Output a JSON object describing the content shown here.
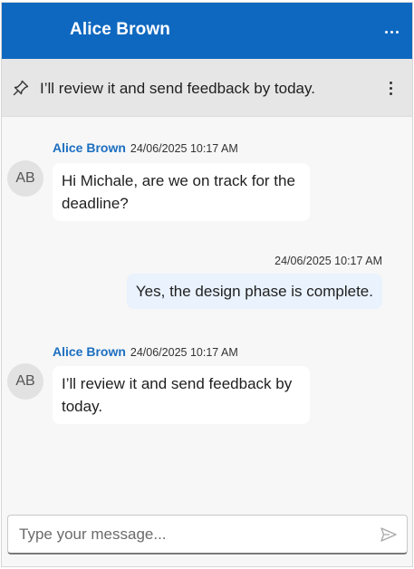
{
  "header": {
    "title": "Alice Brown",
    "menu_icon": "more-horizontal-icon"
  },
  "pinned": {
    "icon": "pin-icon",
    "text": "I’ll review it and send feedback by today.",
    "menu_icon": "more-vertical-icon"
  },
  "messages": [
    {
      "sender": "Alice Brown",
      "time": "24/06/2025 10:17 AM",
      "avatar": "AB",
      "text": "Hi Michale, are we on track for the deadline?",
      "own": false
    },
    {
      "sender": "",
      "time": "24/06/2025 10:17 AM",
      "avatar": "",
      "text": "Yes, the design phase is complete.",
      "own": true
    },
    {
      "sender": "Alice Brown",
      "time": "24/06/2025 10:17 AM",
      "avatar": "AB",
      "text": "I’ll review it and send feedback by today.",
      "own": false
    }
  ],
  "composer": {
    "placeholder": "Type your message...",
    "value": "",
    "send_icon": "send-icon"
  },
  "colors": {
    "header": "#0f68c0",
    "sender_name": "#1c6fc0",
    "own_bubble": "#e9f2fd",
    "pinned_bg": "#e6e6e6"
  }
}
